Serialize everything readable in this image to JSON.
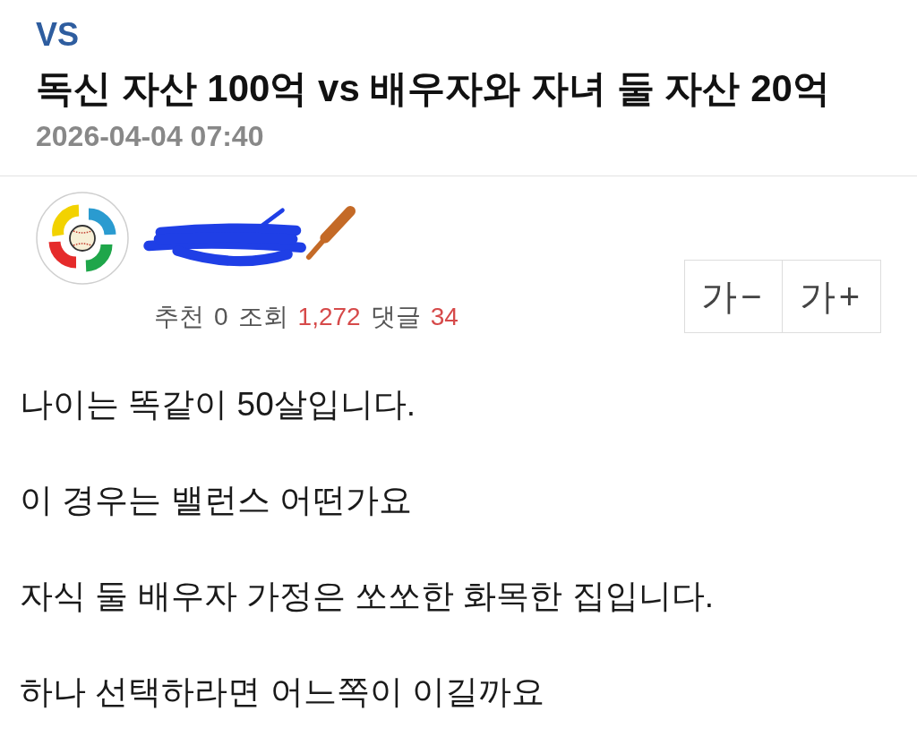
{
  "category": "VS",
  "title": "독신 자산 100억 vs 배우자와 자녀 둘 자산 20억",
  "date": "2026-04-04 07:40",
  "stats": [
    {
      "label": "추천",
      "value": "0",
      "highlight": false
    },
    {
      "label": "조회",
      "value": "1,272",
      "highlight": true
    },
    {
      "label": "댓글",
      "value": "34",
      "highlight": true
    }
  ],
  "font_buttons": [
    {
      "label": "가−"
    },
    {
      "label": "가+"
    }
  ],
  "body": [
    "나이는 똑같이 50살입니다.",
    "이 경우는 밸런스 어떤가요",
    "자식 둘 배우자 가정은 쏘쏘한 화목한 집입니다.",
    "하나 선택하라면 어느쪽이 이길까요"
  ]
}
